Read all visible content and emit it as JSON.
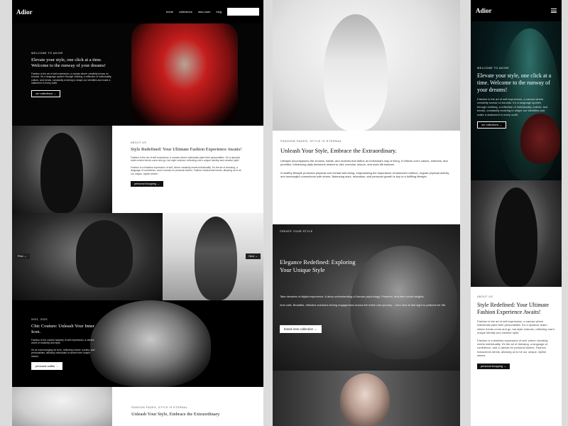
{
  "brand": {
    "logo": "Adior"
  },
  "nav": {
    "links": [
      "home",
      "collections",
      "new-room",
      "blog"
    ],
    "cta": "purchase template"
  },
  "hero": {
    "eyebrow": "WELCOME TO ADIOR",
    "title": "Elevate your style, one click at a time. Welcome to the runway of your dreams!",
    "body": "Fashion is the art of self-expression, a canvas where creativity knows no bounds. It's a language spoken through clothing, a reflection of individuality, culture, and trends, constantly evolving to shape our identities and make a statement in every outfit.",
    "button": "our collections →"
  },
  "about": {
    "eyebrow": "ABOUT US",
    "title": "Style Redefined: Your Ultimate Fashion Experience Awaits!",
    "p1": "Fashion is the art of self-expression, a canvas where individuals paint their personalities. It's a dynamic realm where trends come and go, but style endures, reflecting one's unique identity and creative spirit.",
    "p2": "Fashion is a timeless expression of self, where creativity meets individuality. It's the art of dressing, a language of confidence, and a canvas for personal stories. Fashion transcends trends, allowing us to be our unique, stylish selves.",
    "button": "personal shopping →"
  },
  "gallery": {
    "prev": "Prev ← ",
    "next": "Next →"
  },
  "chic": {
    "eyebrow": "2021, 2022",
    "title": "Chic Couture: Unleash Your Inner Icon.",
    "p1": "Fashion is the colorful tapestry of self-expression, a vibrant world of creativity and style.",
    "p2": "It's an everchanging art form, reflecting culture, society, and personalities, allowing individuals to weave their unique stories.",
    "button": "personal outfits →"
  },
  "lifestyle": {
    "eyebrow": "FASHION FADES, STYLE IS ETERNAL",
    "title": "Unleash Your Style, Embrace the Extraordinary.",
    "p1": "Lifestyle encompasses the choices, habits, and routines that define an individual's way of living. It reflects one's values, interests, and priorities, influencing daily decisions related to diet, exercise, leisure, and work-life balance.",
    "p2": "A healthy lifestyle promotes physical and mental well-being, emphasizing the importance of balanced nutrition, regular physical activity, and meaningful connections with others. Balancing work, relaxation, and personal growth is key to a fulfilling lifestyle."
  },
  "create": {
    "eyebrow": "CREATE YOUR STYLE",
    "title": "Elegance Redefined: Exploring Your Unique Style",
    "p1": "Take decades of digital experience. A deep understanding of human psychology. Powerful, real-time social insights.",
    "p2": "And voilà. Beautiful, effective solutions driving engagement across the entire user journey – from love at first sight to partners for life.",
    "button": "brand new collection →"
  },
  "mobile_about_button": "personal shopping →"
}
